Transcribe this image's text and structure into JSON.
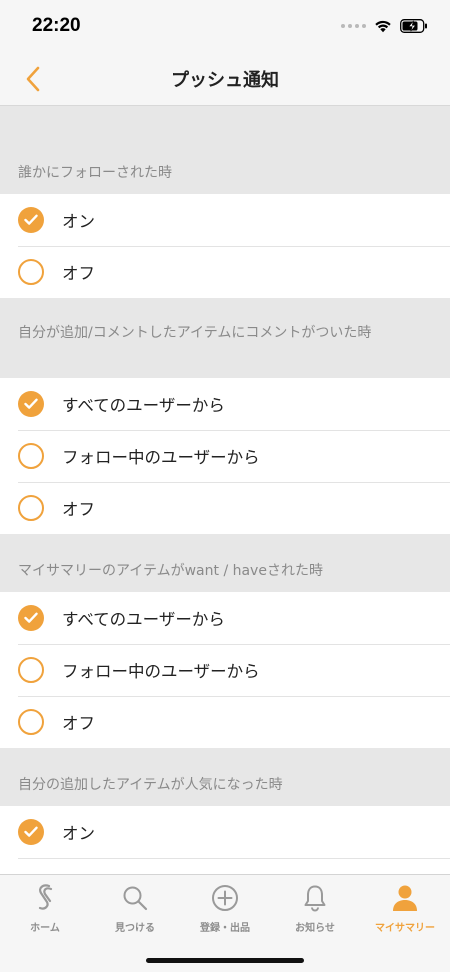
{
  "status": {
    "time": "22:20"
  },
  "nav": {
    "title": "プッシュ通知"
  },
  "sections": [
    {
      "header": "誰かにフォローされた時",
      "options": [
        {
          "label": "オン",
          "selected": true
        },
        {
          "label": "オフ",
          "selected": false
        }
      ]
    },
    {
      "header": "自分が追加/コメントしたアイテムにコメントがついた時",
      "options": [
        {
          "label": "すべてのユーザーから",
          "selected": true
        },
        {
          "label": "フォロー中のユーザーから",
          "selected": false
        },
        {
          "label": "オフ",
          "selected": false
        }
      ]
    },
    {
      "header": "マイサマリーのアイテムがwant / haveされた時",
      "options": [
        {
          "label": "すべてのユーザーから",
          "selected": true
        },
        {
          "label": "フォロー中のユーザーから",
          "selected": false
        },
        {
          "label": "オフ",
          "selected": false
        }
      ]
    },
    {
      "header": "自分の追加したアイテムが人気になった時",
      "options": [
        {
          "label": "オン",
          "selected": true
        }
      ]
    }
  ],
  "tabs": [
    {
      "label": "ホーム",
      "icon": "home-logo-icon",
      "active": false
    },
    {
      "label": "見つける",
      "icon": "search-icon",
      "active": false
    },
    {
      "label": "登録・出品",
      "icon": "add-circle-icon",
      "active": false
    },
    {
      "label": "お知らせ",
      "icon": "bell-icon",
      "active": false
    },
    {
      "label": "マイサマリー",
      "icon": "person-icon",
      "active": true
    }
  ],
  "colors": {
    "accent": "#f0a23c",
    "inactive": "#8e8e8e"
  }
}
